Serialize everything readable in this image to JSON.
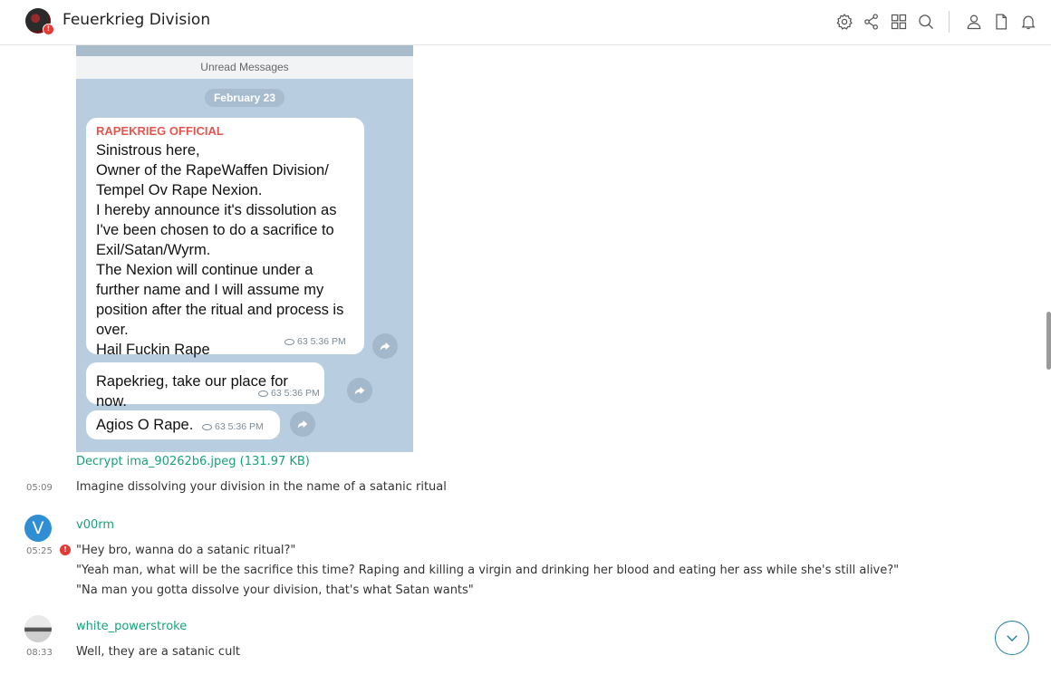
{
  "header": {
    "server_name": "Feuerkrieg Division",
    "badge": "!",
    "icons": [
      "settings-icon",
      "share-icon",
      "grid-icon",
      "search-icon",
      "user-icon",
      "file-icon",
      "bell-icon"
    ]
  },
  "attachment": {
    "telegram": {
      "unread_label": "Unread Messages",
      "date": "February 23",
      "sender": "RAPEKRIEG OFFICIAL",
      "message1_lines": [
        "Sinistrous here,",
        "Owner of the RapeWaffen Division/",
        "Tempel Ov Rape Nexion.",
        "I hereby announce it's dissolution as",
        "I've been chosen to do a sacrifice to",
        "Exil/Satan/Wyrm.",
        "The Nexion will continue under a",
        "further name and I will assume my",
        "position after the ritual and process is",
        "over.",
        "Hail Fuckin Rape"
      ],
      "message1_meta": "63 5:36 PM",
      "message2": "Rapekrieg, take our place for now.",
      "message2_meta": "63 5:36 PM",
      "message3": "Agios O Rape.",
      "message3_meta": "63 5:36 PM"
    },
    "decrypt_link": "Decrypt ima_90262b6.jpeg (131.97 KB)"
  },
  "messages": [
    {
      "time": "05:09",
      "text": "Imagine dissolving your division in the name of a satanic ritual"
    },
    {
      "author": "v00rm",
      "avatar_letter": "V",
      "time": "05:25",
      "badge": "!",
      "lines": [
        "\"Hey bro, wanna do a satanic ritual?\"",
        "\"Yeah man, what will be the sacrifice this time? Raping and killing a virgin and drinking her blood and eating her ass while she's still alive?\"",
        "\"Na man you gotta dissolve your division, that's what Satan wants\""
      ]
    },
    {
      "author": "white_powerstroke",
      "time": "08:33",
      "text": "Well, they are a satanic cult"
    }
  ],
  "colors": {
    "link": "#1aa07c",
    "avatar_v": "#2f8ed4",
    "badge": "#e53935",
    "accent": "#1a7fa8"
  }
}
